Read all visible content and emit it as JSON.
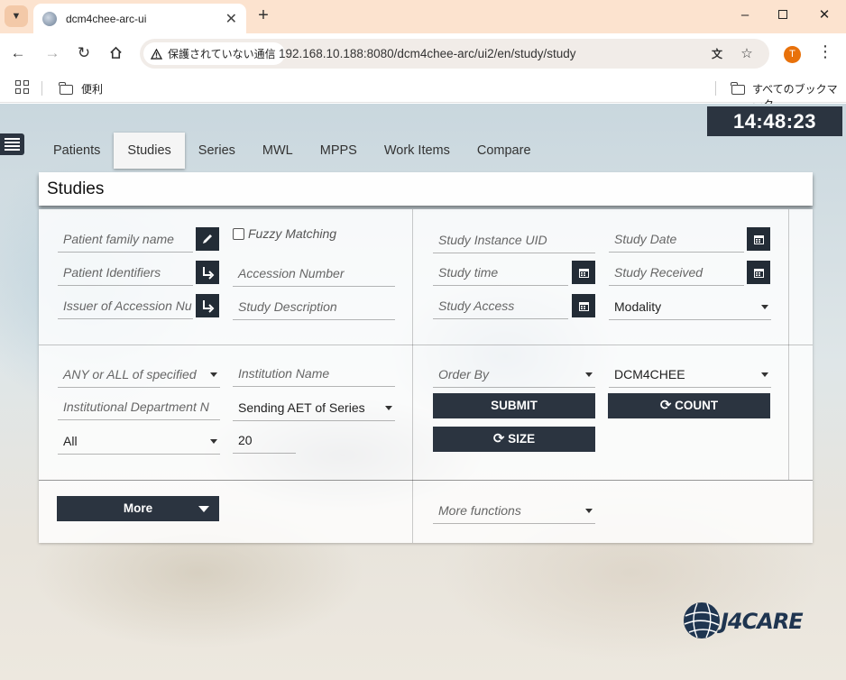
{
  "browser": {
    "tab_title": "dcm4chee-arc-ui",
    "security_label": "保護されていない通信",
    "url": "192.168.10.188:8080/dcm4chee-arc/ui2/en/study/study",
    "profile_initial": "T",
    "bookmarks": {
      "folder": "便利",
      "all_bookmarks": "すべてのブックマーク"
    }
  },
  "clock": "14:48:23",
  "nav": {
    "tabs": [
      "Patients",
      "Studies",
      "Series",
      "MWL",
      "MPPS",
      "Work Items",
      "Compare"
    ],
    "active": "Studies"
  },
  "page_title": "Studies",
  "filters": {
    "patient_family_name": "Patient family name",
    "fuzzy_matching": "Fuzzy Matching",
    "patient_identifiers": "Patient Identifiers",
    "accession_number": "Accession Number",
    "issuer_of_accession": "Issuer of Accession Nu",
    "study_description": "Study Description",
    "study_instance_uid": "Study Instance UID",
    "study_date": "Study Date",
    "study_time": "Study time",
    "study_received": "Study Received",
    "study_access": "Study Access",
    "modality": "Modality",
    "any_or_all": "ANY or ALL of specified",
    "institution_name": "Institution Name",
    "institutional_department": "Institutional Department N",
    "sending_aet": "Sending AET of Series",
    "all_select": "All",
    "limit": "20",
    "order_by": "Order By",
    "aet": "DCM4CHEE"
  },
  "buttons": {
    "submit": "SUBMIT",
    "count": "COUNT",
    "size": "SIZE",
    "more": "More",
    "more_functions": "More functions"
  },
  "logo_text": "J4CARE",
  "colors": {
    "dark": "#2b3440",
    "tab_bar": "#fce3cf",
    "profile": "#e8710a"
  }
}
